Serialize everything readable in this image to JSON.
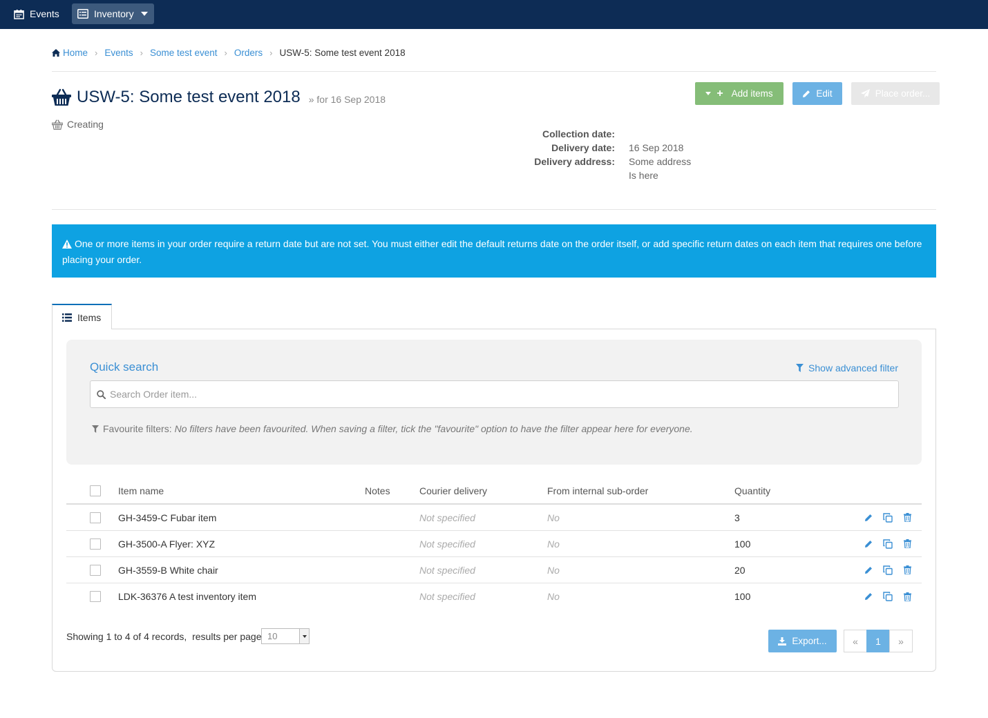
{
  "nav": {
    "events_label": "Events",
    "inventory_label": "Inventory"
  },
  "breadcrumb": {
    "home": "Home",
    "events": "Events",
    "event": "Some test event",
    "orders": "Orders",
    "current": "USW-5: Some test event 2018"
  },
  "order": {
    "title": "USW-5: Some test event 2018",
    "subtitle": "» for 16 Sep 2018",
    "status": "Creating"
  },
  "actions": {
    "add_items": "Add items",
    "edit": "Edit",
    "place_order": "Place order..."
  },
  "details": {
    "collection_label": "Collection date:",
    "collection_value": "",
    "delivery_label": "Delivery date:",
    "delivery_value": "16 Sep 2018",
    "address_label": "Delivery address:",
    "address_line1": "Some address",
    "address_line2": "Is here"
  },
  "alert": {
    "text": "One or more items in your order require a return date but are not set. You must either edit the default returns date on the order itself, or add specific return dates on each item that requires one before placing your order."
  },
  "tabs": {
    "items": "Items"
  },
  "search": {
    "title": "Quick search",
    "advanced": "Show advanced filter",
    "placeholder": "Search Order item...",
    "fav_label": "Favourite filters:",
    "fav_text": "No filters have been favourited. When saving a filter, tick the \"favourite\" option to have the filter appear here for everyone."
  },
  "table": {
    "headers": {
      "name": "Item name",
      "notes": "Notes",
      "courier": "Courier delivery",
      "sub_order": "From internal sub-order",
      "quantity": "Quantity"
    },
    "rows": [
      {
        "name": "GH-3459-C Fubar item",
        "notes": "",
        "courier": "Not specified",
        "sub_order": "No",
        "quantity": "3"
      },
      {
        "name": "GH-3500-A Flyer: XYZ",
        "notes": "",
        "courier": "Not specified",
        "sub_order": "No",
        "quantity": "100"
      },
      {
        "name": "GH-3559-B White chair",
        "notes": "",
        "courier": "Not specified",
        "sub_order": "No",
        "quantity": "20"
      },
      {
        "name": "LDK-36376 A test inventory item",
        "notes": "",
        "courier": "Not specified",
        "sub_order": "No",
        "quantity": "100"
      }
    ]
  },
  "footer": {
    "showing": "Showing 1 to 4 of 4 records,  results per page:",
    "per_page": "10",
    "export": "Export...",
    "page_prev": "«",
    "page_current": "1",
    "page_next": "»"
  },
  "colors": {
    "navbar": "#0d2c55",
    "link": "#3a8fd4",
    "alert": "#0ea2e2",
    "add_button": "#85bd78",
    "primary_button": "#6cb2e4"
  },
  "icons": {
    "events": "calendar-icon",
    "inventory": "list-box-icon",
    "home": "home-icon",
    "order": "basket-icon",
    "alert": "warning-icon",
    "filter": "filter-icon",
    "search": "search-icon",
    "row_edit": "pencil-icon",
    "row_copy": "copy-icon",
    "row_delete": "trash-icon",
    "export": "download-icon"
  }
}
